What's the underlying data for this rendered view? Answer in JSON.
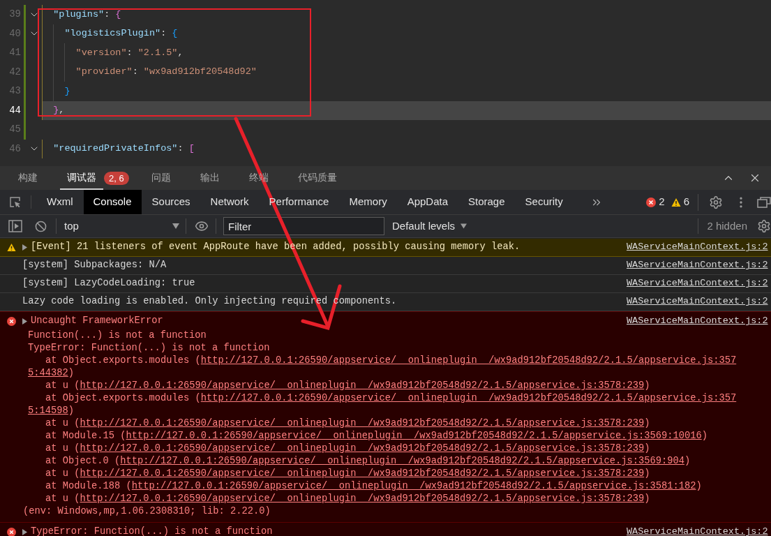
{
  "editor": {
    "lines": [
      {
        "number": "39",
        "fold": true,
        "modified": true,
        "current": false,
        "tokens": [
          {
            "text": "  \"plugins\"",
            "kind": "key"
          },
          {
            "text": ": ",
            "kind": "punct"
          },
          {
            "text": "{",
            "kind": "brace1"
          }
        ]
      },
      {
        "number": "40",
        "fold": true,
        "modified": true,
        "current": false,
        "tokens": [
          {
            "text": "    \"logisticsPlugin\"",
            "kind": "key"
          },
          {
            "text": ": ",
            "kind": "punct"
          },
          {
            "text": "{",
            "kind": "brace2"
          }
        ]
      },
      {
        "number": "41",
        "fold": false,
        "modified": true,
        "current": false,
        "tokens": [
          {
            "text": "      \"version\"",
            "kind": "string"
          },
          {
            "text": ": ",
            "kind": "punct"
          },
          {
            "text": "\"2.1.5\"",
            "kind": "string"
          },
          {
            "text": ",",
            "kind": "punct"
          }
        ]
      },
      {
        "number": "42",
        "fold": false,
        "modified": true,
        "current": false,
        "tokens": [
          {
            "text": "      \"provider\"",
            "kind": "string"
          },
          {
            "text": ": ",
            "kind": "punct"
          },
          {
            "text": "\"wx9ad912bf20548d92\"",
            "kind": "string"
          }
        ]
      },
      {
        "number": "43",
        "fold": false,
        "modified": true,
        "current": false,
        "tokens": [
          {
            "text": "    }",
            "kind": "brace2"
          }
        ]
      },
      {
        "number": "44",
        "fold": false,
        "modified": true,
        "current": true,
        "tokens": [
          {
            "text": "  }",
            "kind": "brace1"
          },
          {
            "text": ",",
            "kind": "punct"
          }
        ]
      },
      {
        "number": "45",
        "fold": false,
        "modified": true,
        "current": false
      },
      {
        "number": "46",
        "fold": true,
        "modified": false,
        "current": false,
        "tokens": [
          {
            "text": "  \"requiredPrivateInfos\"",
            "kind": "key"
          },
          {
            "text": ": ",
            "kind": "punct"
          },
          {
            "text": "[",
            "kind": "brace1"
          }
        ]
      }
    ]
  },
  "panel_tabs": [
    {
      "label": "构建",
      "selected": false
    },
    {
      "label": "调试器",
      "selected": true,
      "badge": "2, 6"
    },
    {
      "label": "问题",
      "selected": false
    },
    {
      "label": "输出",
      "selected": false
    },
    {
      "label": "终端",
      "selected": false
    },
    {
      "label": "代码质量",
      "selected": false
    }
  ],
  "devtools_tabs": [
    {
      "label": "Wxml",
      "selected": false
    },
    {
      "label": "Console",
      "selected": true
    },
    {
      "label": "Sources",
      "selected": false
    },
    {
      "label": "Network",
      "selected": false
    },
    {
      "label": "Performance",
      "selected": false
    },
    {
      "label": "Memory",
      "selected": false
    },
    {
      "label": "AppData",
      "selected": false
    },
    {
      "label": "Storage",
      "selected": false
    },
    {
      "label": "Security",
      "selected": false
    }
  ],
  "counts": {
    "errors": "2",
    "warnings": "6"
  },
  "toolbar": {
    "context": "top",
    "filter_placeholder": "Filter",
    "levels": "Default levels",
    "hidden": "2 hidden"
  },
  "messages": [
    {
      "kind": "warning",
      "expandable": true,
      "text": "[Event] 21 listeners of event AppRoute have been added, possibly causing memory leak.",
      "source": "WAServiceMainContext.js:2"
    },
    {
      "kind": "log",
      "expandable": false,
      "text": "[system] Subpackages: N/A",
      "source": "WAServiceMainContext.js:2"
    },
    {
      "kind": "log",
      "expandable": false,
      "text": "[system] LazyCodeLoading: true",
      "source": "WAServiceMainContext.js:2"
    },
    {
      "kind": "log",
      "expandable": false,
      "text": "Lazy code loading is enabled. Only injecting required components.",
      "source": "WAServiceMainContext.js:2"
    },
    {
      "kind": "error",
      "expandable": true,
      "text": "Uncaught FrameworkError",
      "source": "WAServiceMainContext.js:2",
      "details": [
        "Function(...) is not a function",
        "TypeError: Function(...) is not a function"
      ],
      "stack": [
        {
          "prefix": "at Object.exports.modules (",
          "url": "http://127.0.0.1:26590/appservice/__onlineplugin__/wx9ad912bf20548d92/2.1.5/appservice.js:3575:44382",
          "suffix": ")"
        },
        {
          "prefix": "at u (",
          "url": "http://127.0.0.1:26590/appservice/__onlineplugin__/wx9ad912bf20548d92/2.1.5/appservice.js:3578:239",
          "suffix": ")"
        },
        {
          "prefix": "at Object.exports.modules (",
          "url": "http://127.0.0.1:26590/appservice/__onlineplugin__/wx9ad912bf20548d92/2.1.5/appservice.js:3575:14598",
          "suffix": ")"
        },
        {
          "prefix": "at u (",
          "url": "http://127.0.0.1:26590/appservice/__onlineplugin__/wx9ad912bf20548d92/2.1.5/appservice.js:3578:239",
          "suffix": ")"
        },
        {
          "prefix": "at Module.15 (",
          "url": "http://127.0.0.1:26590/appservice/__onlineplugin__/wx9ad912bf20548d92/2.1.5/appservice.js:3569:10016",
          "suffix": ")"
        },
        {
          "prefix": "at u (",
          "url": "http://127.0.0.1:26590/appservice/__onlineplugin__/wx9ad912bf20548d92/2.1.5/appservice.js:3578:239",
          "suffix": ")"
        },
        {
          "prefix": "at Object.0 (",
          "url": "http://127.0.0.1:26590/appservice/__onlineplugin__/wx9ad912bf20548d92/2.1.5/appservice.js:3569:904",
          "suffix": ")"
        },
        {
          "prefix": "at u (",
          "url": "http://127.0.0.1:26590/appservice/__onlineplugin__/wx9ad912bf20548d92/2.1.5/appservice.js:3578:239",
          "suffix": ")"
        },
        {
          "prefix": "at Module.188 (",
          "url": "http://127.0.0.1:26590/appservice/__onlineplugin__/wx9ad912bf20548d92/2.1.5/appservice.js:3581:182",
          "suffix": ")"
        },
        {
          "prefix": "at u (",
          "url": "http://127.0.0.1:26590/appservice/__onlineplugin__/wx9ad912bf20548d92/2.1.5/appservice.js:3578:239",
          "suffix": ")"
        }
      ],
      "env": "(env: Windows,mp,1.06.2308310; lib: 2.22.0)"
    },
    {
      "kind": "error",
      "expandable": true,
      "text": "TypeError: Function(...) is not a function",
      "source": "WAServiceMainContext.js:2"
    }
  ]
}
